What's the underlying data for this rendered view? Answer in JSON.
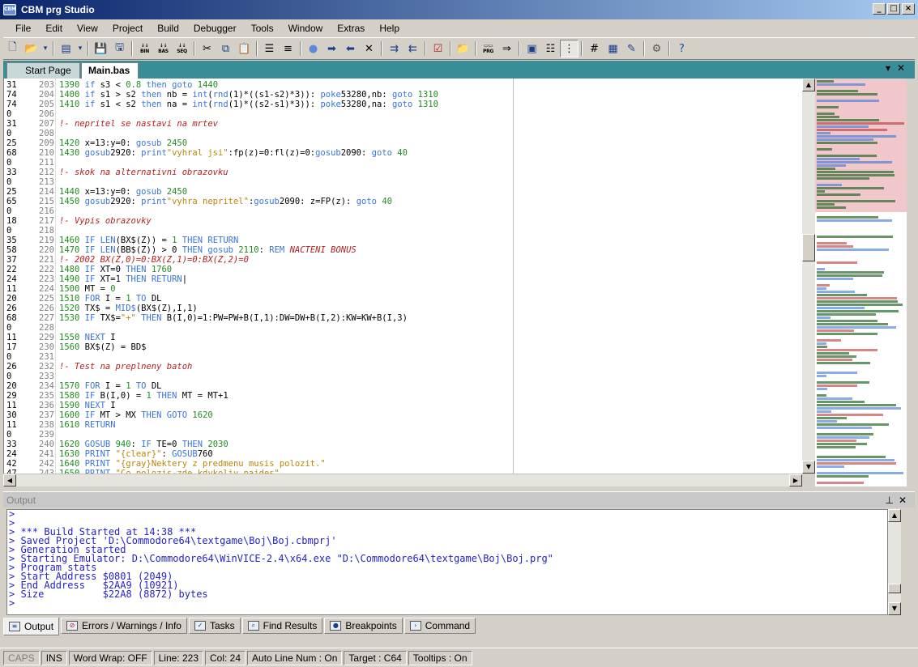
{
  "window": {
    "title": "CBM prg Studio",
    "app_icon": "CBM"
  },
  "menu": [
    "File",
    "Edit",
    "View",
    "Project",
    "Build",
    "Debugger",
    "Tools",
    "Window",
    "Extras",
    "Help"
  ],
  "toolbar_labels": {
    "bin": "BIN",
    "bas": "BAS",
    "seq": "SEQ",
    "prg": "PRG"
  },
  "tabs": [
    {
      "label": "Start Page"
    },
    {
      "label": "Main.bas"
    }
  ],
  "editor": {
    "lines": [
      {
        "count": "31",
        "num": "203",
        "html": "<span class='num'>1390</span> <span class='kw'>if</span> s3 &lt; <span class='num'>0.8</span> <span class='kw'>then goto</span> <span class='num'>1440</span>"
      },
      {
        "count": "74",
        "num": "204",
        "html": "<span class='num'>1400</span> <span class='kw'>if</span> s1 &gt; s2 <span class='kw'>then</span> nb = <span class='kw'>int</span>(<span class='kw'>rnd</span>(1)*((s1-s2)*3)): <span class='kw'>poke</span>53280,nb: <span class='kw'>goto</span> <span class='num'>1310</span>"
      },
      {
        "count": "74",
        "num": "205",
        "html": "<span class='num'>1410</span> <span class='kw'>if</span> s1 &lt; s2 <span class='kw'>then</span> na = <span class='kw'>int</span>(<span class='kw'>rnd</span>(1)*((s2-s1)*3)): <span class='kw'>poke</span>53280,na: <span class='kw'>goto</span> <span class='num'>1310</span>"
      },
      {
        "count": "0",
        "num": "206",
        "html": ""
      },
      {
        "count": "31",
        "num": "207",
        "html": "<span class='rem'>!- nepritel se nastavi na mrtev</span>"
      },
      {
        "count": "0",
        "num": "208",
        "html": ""
      },
      {
        "count": "25",
        "num": "209",
        "html": "<span class='num'>1420</span> x=13:y=0: <span class='kw'>gosub</span> <span class='num'>2450</span>"
      },
      {
        "count": "68",
        "num": "210",
        "html": "<span class='num'>1430</span> <span class='kw'>gosub</span>2920: <span class='kw'>print</span><span class='str'>\"vyhral jsi\"</span>:fp(z)=0:fl(z)=0:<span class='kw'>gosub</span>2090: <span class='kw'>goto</span> <span class='num'>40</span>"
      },
      {
        "count": "0",
        "num": "211",
        "html": ""
      },
      {
        "count": "33",
        "num": "212",
        "html": "<span class='rem'>!- skok na alternativni obrazovku</span>"
      },
      {
        "count": "0",
        "num": "213",
        "html": ""
      },
      {
        "count": "25",
        "num": "214",
        "html": "<span class='num'>1440</span> x=13:y=0: <span class='kw'>gosub</span> <span class='num'>2450</span>"
      },
      {
        "count": "65",
        "num": "215",
        "html": "<span class='num'>1450</span> <span class='kw'>gosub</span>2920: <span class='kw'>print</span><span class='str'>\"vyhra nepritel\"</span>:<span class='kw'>gosub</span>2090: z=FP(z): <span class='kw'>goto</span> <span class='num'>40</span>"
      },
      {
        "count": "0",
        "num": "216",
        "html": ""
      },
      {
        "count": "18",
        "num": "217",
        "html": "<span class='rem'>!- Vypis obrazovky</span>"
      },
      {
        "count": "0",
        "num": "218",
        "html": ""
      },
      {
        "count": "35",
        "num": "219",
        "html": "<span class='num'>1460</span> <span class='kw'>IF</span> <span class='kw'>LEN</span>(BX$(Z)) = <span class='num'>1</span> <span class='kw'>THEN RETURN</span>"
      },
      {
        "count": "58",
        "num": "220",
        "html": "<span class='num'>1470</span> <span class='kw'>IF</span> <span class='kw'>LEN</span>(BB$(Z)) &gt; 0 <span class='kw'>THEN</span> <span class='kw'>gosub</span> <span class='num'>2110</span>: <span class='kw'>REM</span> <span class='rem'>NACTENI BONUS</span>"
      },
      {
        "count": "37",
        "num": "221",
        "html": "<span class='rem'>!- 2002 BX(Z,0)=0:BX(Z,1)=0:BX(Z,2)=0</span>"
      },
      {
        "count": "22",
        "num": "222",
        "html": "<span class='num'>1480</span> <span class='kw'>IF</span> XT=0 <span class='kw'>THEN</span> <span class='num'>1760</span>"
      },
      {
        "count": "24",
        "num": "223",
        "html": "<span class='num'>1490</span> <span class='kw'>IF</span> XT=1 <span class='kw'>THEN RETURN</span>|"
      },
      {
        "count": "11",
        "num": "224",
        "html": "<span class='num'>1500</span> MT = <span class='num'>0</span>"
      },
      {
        "count": "20",
        "num": "225",
        "html": "<span class='num'>1510</span> <span class='kw'>FOR</span> I = <span class='num'>1</span> <span class='kw'>TO</span> DL"
      },
      {
        "count": "26",
        "num": "226",
        "html": "<span class='num'>1520</span> TX$ = <span class='kw'>MID$</span>(BX$(Z),I,1)"
      },
      {
        "count": "68",
        "num": "227",
        "html": "<span class='num'>1530</span> <span class='kw'>IF</span> TX$=<span class='str'>\"+\"</span> <span class='kw'>THEN</span> B(I,0)=1:PW=PW+B(I,1):DW=DW+B(I,2):KW=KW+B(I,3)"
      },
      {
        "count": "0",
        "num": "228",
        "html": ""
      },
      {
        "count": "11",
        "num": "229",
        "html": "<span class='num'>1550</span> <span class='kw'>NEXT</span> I"
      },
      {
        "count": "17",
        "num": "230",
        "html": "<span class='num'>1560</span> BX$(Z) = BD$"
      },
      {
        "count": "0",
        "num": "231",
        "html": ""
      },
      {
        "count": "26",
        "num": "232",
        "html": "<span class='rem'>!- Test na preplneny batoh</span>"
      },
      {
        "count": "0",
        "num": "233",
        "html": ""
      },
      {
        "count": "20",
        "num": "234",
        "html": "<span class='num'>1570</span> <span class='kw'>FOR</span> I = <span class='num'>1</span> <span class='kw'>TO</span> DL"
      },
      {
        "count": "29",
        "num": "235",
        "html": "<span class='num'>1580</span> <span class='kw'>IF</span> B(I,0) = <span class='num'>1</span> <span class='kw'>THEN</span> MT = MT+1"
      },
      {
        "count": "11",
        "num": "236",
        "html": "<span class='num'>1590</span> <span class='kw'>NEXT</span> I"
      },
      {
        "count": "30",
        "num": "237",
        "html": "<span class='num'>1600</span> <span class='kw'>IF</span> MT &gt; MX <span class='kw'>THEN GOTO</span> <span class='num'>1620</span>"
      },
      {
        "count": "11",
        "num": "238",
        "html": "<span class='num'>1610</span> <span class='kw'>RETURN</span>"
      },
      {
        "count": "0",
        "num": "239",
        "html": ""
      },
      {
        "count": "33",
        "num": "240",
        "html": "<span class='num'>1620</span> <span class='kw'>GOSUB</span> <span class='num'>940</span>: <span class='kw'>IF</span> TE=0 <span class='kw'>THEN</span> <span class='num'>2030</span>"
      },
      {
        "count": "24",
        "num": "241",
        "html": "<span class='num'>1630</span> <span class='kw'>PRINT</span> <span class='str'>\"{clear}\"</span>: <span class='kw'>GOSUB</span>760"
      },
      {
        "count": "42",
        "num": "242",
        "html": "<span class='num'>1640</span> <span class='kw'>PRINT</span> <span class='str'>\"{gray}Nektery z predmenu musis polozit.\"</span>"
      },
      {
        "count": "47",
        "num": "243",
        "html": "<span class='num'>1650</span> <span class='kw'>PRINT</span> <span class='str'>\"Co polozis-zde kdykoliv najdes\"</span>"
      }
    ]
  },
  "output": {
    "title": "Output",
    "lines": [
      "> ",
      ">",
      "> *** Build Started at 14:38 ***",
      "> Saved Project 'D:\\Commodore64\\textgame\\Boj\\Boj.cbmprj'",
      "> Generation started",
      "> Starting Emulator: D:\\Commodore64\\WinVICE-2.4\\x64.exe \"D:\\Commodore64\\textgame\\Boj\\Boj.prg\"",
      "> Program stats",
      "> Start Address $0801 (2049)",
      "> End Address   $2AA9 (10921)",
      "> Size          $22A8 (8872) bytes",
      ">"
    ]
  },
  "bottom_tabs": [
    {
      "label": "Output",
      "icon": "output-icon"
    },
    {
      "label": "Errors / Warnings / Info",
      "icon": "errors-icon"
    },
    {
      "label": "Tasks",
      "icon": "tasks-icon"
    },
    {
      "label": "Find Results",
      "icon": "find-results-icon"
    },
    {
      "label": "Breakpoints",
      "icon": "breakpoints-icon"
    },
    {
      "label": "Command",
      "icon": "command-icon"
    }
  ],
  "status": {
    "caps": "CAPS",
    "ins": "INS",
    "word_wrap": "Word Wrap: OFF",
    "line": "Line: 223",
    "col": "Col: 24",
    "auto_line": "Auto Line Num : On",
    "target": "Target : C64",
    "tooltips": "Tooltips : On"
  }
}
